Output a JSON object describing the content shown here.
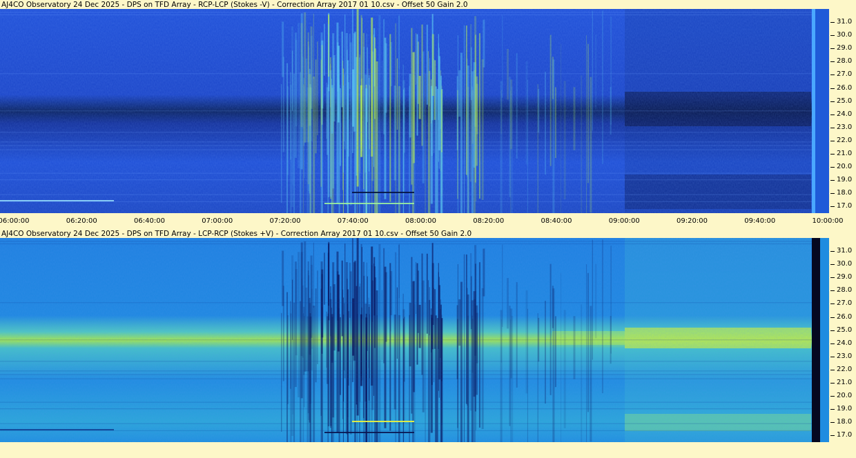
{
  "panel1": {
    "title": "AJ4CO Observatory 24 Dec 2025  -  DPS on TFD Array  -  RCP-LCP (Stokes -V)  -  Correction Array 2017 01 10.csv  -  Offset 50  Gain 2.0"
  },
  "panel2": {
    "title": "AJ4CO Observatory 24 Dec 2025  -  DPS on TFD Array  -  LCP-RCP (Stokes +V)  -  Correction Array 2017 01 10.csv  -  Offset 50  Gain 2.0"
  },
  "freq_ticks": [
    "31.0",
    "30.0",
    "29.0",
    "28.0",
    "27.0",
    "26.0",
    "25.0",
    "24.0",
    "23.0",
    "22.0",
    "21.0",
    "20.0",
    "19.0",
    "18.0",
    "17.0"
  ],
  "time_ticks": [
    "06:00:00",
    "06:20:00",
    "06:40:00",
    "07:00:00",
    "07:20:00",
    "07:40:00",
    "08:00:00",
    "08:20:00",
    "08:40:00",
    "09:00:00",
    "09:20:00",
    "09:40:00",
    "10:00:00"
  ],
  "colors": {
    "background": "#fdf7c8",
    "panel1_base": "#1f4fd6",
    "panel1_dark_band": "#071d5c",
    "panel1_burst": "#8ff07a",
    "panel2_base": "#1c8ae0",
    "panel2_bright_band": "#b8f046",
    "panel2_burst": "#0a1a66"
  }
}
